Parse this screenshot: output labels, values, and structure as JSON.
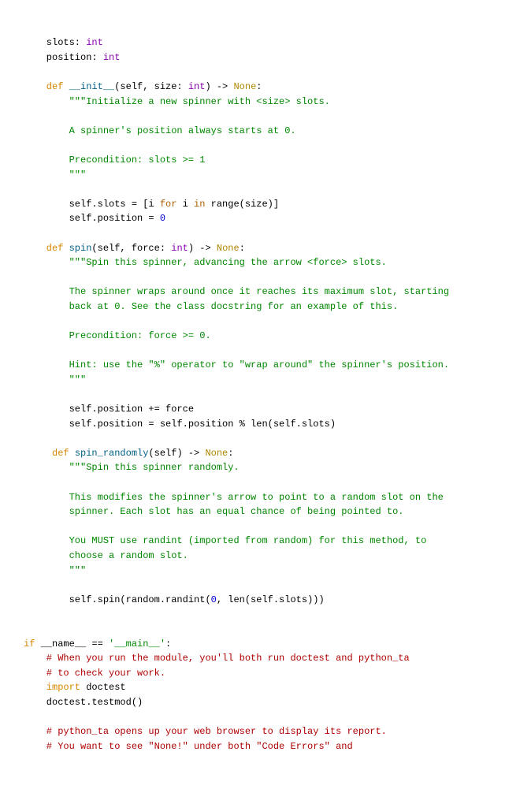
{
  "code": {
    "slots_decl_pre": "    slots: ",
    "int1": "int",
    "pos_decl_pre": "    position: ",
    "int2": "int",
    "blank1": "",
    "def1_kw": "    def ",
    "def1_fn": "__init__",
    "def1_mid": "(self, size: ",
    "def1_int": "int",
    "def1_arrow": ") -> ",
    "def1_none": "None",
    "def1_end": ":",
    "doc1_l1": "        \"\"\"Initialize a new spinner with <size> slots.",
    "blank2": "",
    "doc1_l2": "        A spinner's position always starts at 0.",
    "blank3": "",
    "doc1_l3": "        Precondition: slots >= 1",
    "doc1_l4": "        \"\"\"",
    "blank4": "",
    "slots_assign_pre": "        self.slots = [i ",
    "for1": "for",
    "slots_assign_mid": " i ",
    "in1": "in",
    "slots_assign_post": " range(size)]",
    "pos_assign_pre": "        self.position = ",
    "zero1": "0",
    "blank5": "",
    "def2_kw": "    def ",
    "def2_fn": "spin",
    "def2_mid": "(self, force: ",
    "def2_int": "int",
    "def2_arrow": ") -> ",
    "def2_none": "None",
    "def2_end": ":",
    "doc2_l1": "        \"\"\"Spin this spinner, advancing the arrow <force> slots.",
    "blank6": "",
    "doc2_l2": "        The spinner wraps around once it reaches its maximum slot, starting",
    "doc2_l3": "        back at 0. See the class docstring for an example of this.",
    "blank7": "",
    "doc2_l4": "        Precondition: force >= 0.",
    "blank8": "",
    "doc2_l5": "        Hint: use the \"%\" operator to \"wrap around\" the spinner's position.",
    "doc2_l6": "        \"\"\"",
    "blank9": "",
    "spin_body1": "        self.position += force",
    "spin_body2": "        self.position = self.position % len(self.slots)",
    "blank10": "",
    "def3_kw": "     def ",
    "def3_fn": "spin_randomly",
    "def3_mid": "(self) -> ",
    "def3_none": "None",
    "def3_end": ":",
    "doc3_l1": "        \"\"\"Spin this spinner randomly.",
    "blank11": "",
    "doc3_l2": "        This modifies the spinner's arrow to point to a random slot on the",
    "doc3_l3": "        spinner. Each slot has an equal chance of being pointed to.",
    "blank12": "",
    "doc3_l4": "        You MUST use randint (imported from random) for this method, to",
    "doc3_l5": "        choose a random slot.",
    "doc3_l6": "        \"\"\"",
    "blank13": "",
    "rand_body_pre": "        self.spin(random.randint(",
    "rand_zero": "0",
    "rand_body_post": ", len(self.slots)))",
    "blank14": "",
    "blank15": "",
    "if_kw": "if",
    "if_mid": " __name__ == ",
    "if_str": "'__main__'",
    "if_end": ":",
    "com1": "    # When you run the module, you'll both run doctest and python_ta",
    "com2": "    # to check your work.",
    "imp_kw": "    import",
    "imp_mod": " doctest",
    "testmod": "    doctest.testmod()",
    "blank16": "",
    "com3": "    # python_ta opens up your web browser to display its report.",
    "com4": "    # You want to see \"None!\" under both \"Code Errors\" and"
  }
}
